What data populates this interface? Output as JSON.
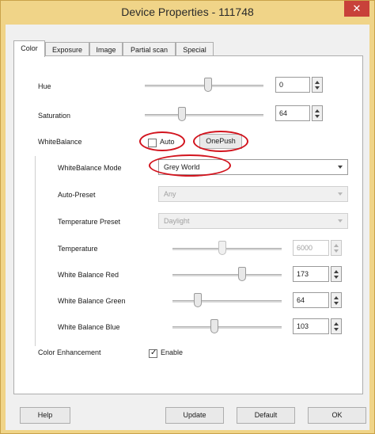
{
  "window": {
    "title": "Device Properties - 111748",
    "close_glyph": "✕"
  },
  "tabs": [
    {
      "label": "Color"
    },
    {
      "label": "Exposure"
    },
    {
      "label": "Image"
    },
    {
      "label": "Partial scan"
    },
    {
      "label": "Special"
    }
  ],
  "color": {
    "hue": {
      "label": "Hue",
      "value": "0"
    },
    "saturation": {
      "label": "Saturation",
      "value": "64"
    },
    "whitebalance": {
      "label": "WhiteBalance",
      "auto_label": "Auto",
      "auto_checked": false,
      "onepush_label": "OnePush"
    },
    "wb_mode": {
      "label": "WhiteBalance Mode",
      "value": "Grey World"
    },
    "auto_preset": {
      "label": "Auto-Preset",
      "value": "Any"
    },
    "temp_preset": {
      "label": "Temperature Preset",
      "value": "Daylight"
    },
    "temperature": {
      "label": "Temperature",
      "value": "6000"
    },
    "wb_red": {
      "label": "White Balance Red",
      "value": "173"
    },
    "wb_green": {
      "label": "White Balance Green",
      "value": "64"
    },
    "wb_blue": {
      "label": "White Balance Blue",
      "value": "103"
    },
    "enhancement": {
      "label": "Color Enhancement",
      "enable_label": "Enable",
      "enabled": true
    }
  },
  "buttons": {
    "help": "Help",
    "update": "Update",
    "default": "Default",
    "ok": "OK"
  },
  "colors": {
    "frame": "#f0d488",
    "close": "#c8413a",
    "highlight_ring": "#d2141e"
  }
}
